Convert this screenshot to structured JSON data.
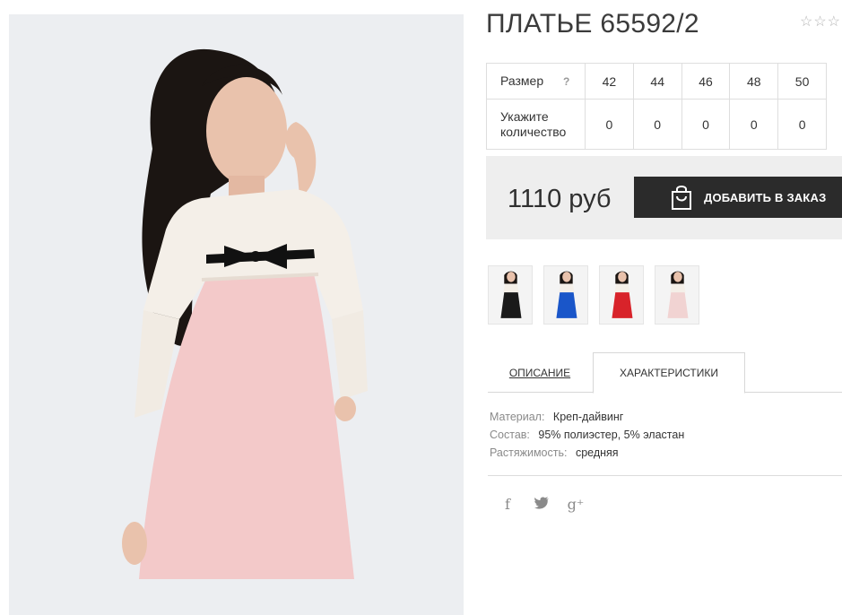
{
  "product": {
    "title": "ПЛАТЬЕ 65592/2",
    "rating_stars": [
      "☆",
      "☆",
      "☆"
    ]
  },
  "sizes": {
    "label": "Размер",
    "help": "?",
    "values": [
      "42",
      "44",
      "46",
      "48",
      "50"
    ],
    "qty_label": "Укажите количество",
    "quantities": [
      "0",
      "0",
      "0",
      "0",
      "0"
    ]
  },
  "buy": {
    "price": "1110 руб",
    "button_label": "ДОБАВИТЬ В ЗАКАЗ",
    "icon": "shopping-bag-icon"
  },
  "thumbnails": [
    {
      "color": "#1a1a1a"
    },
    {
      "color": "#1a56c9"
    },
    {
      "color": "#d8232a"
    },
    {
      "color": "#f1d3d2"
    }
  ],
  "tabs": [
    {
      "label": "ОПИСАНИЕ",
      "active": false
    },
    {
      "label": "ХАРАКТЕРИСТИКИ",
      "active": true
    }
  ],
  "specs": [
    {
      "key": "Материал:",
      "value": "Креп-дайвинг"
    },
    {
      "key": "Состав:",
      "value": "95% полиэстер, 5% эластан"
    },
    {
      "key": "Растяжимость:",
      "value": "средняя"
    }
  ],
  "social": [
    {
      "icon": "facebook-icon",
      "glyph": "f"
    },
    {
      "icon": "twitter-icon",
      "glyph": "🐦"
    },
    {
      "icon": "google-plus-icon",
      "glyph": "g⁺"
    }
  ],
  "colors": {
    "dress": "#f3c9c9",
    "lace": "#f4efe8",
    "hair": "#1b1512",
    "skin": "#e9c2ac",
    "background": "#eceef1",
    "button": "#2b2b2b"
  }
}
